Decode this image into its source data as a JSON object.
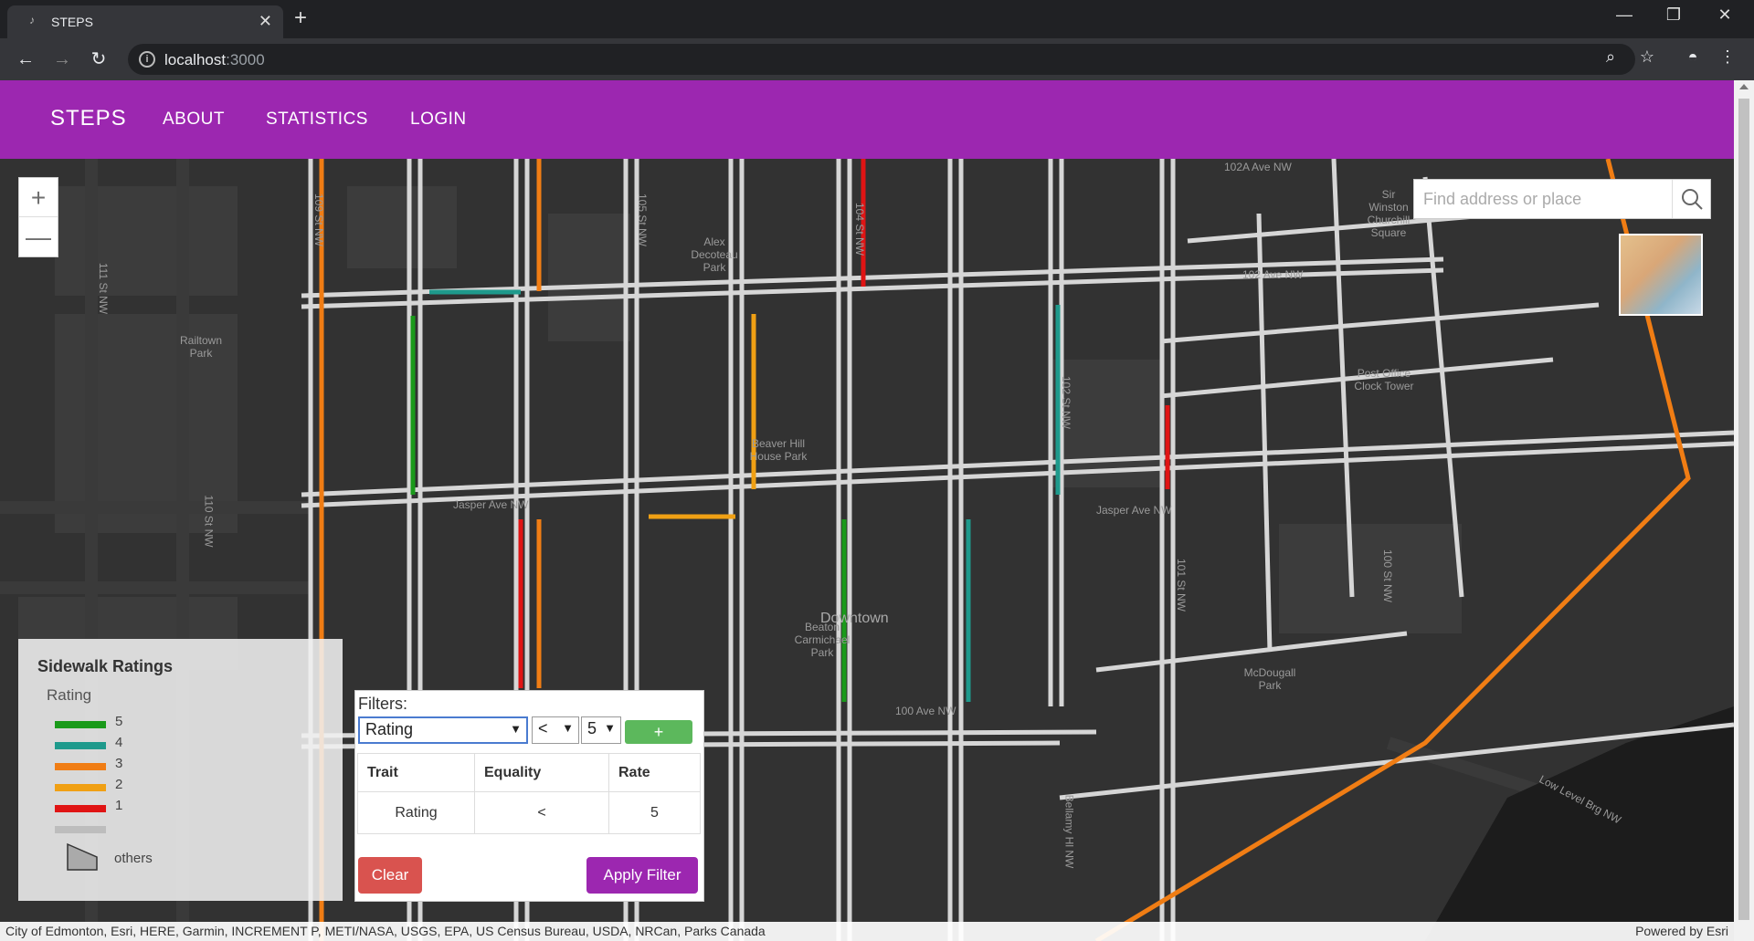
{
  "browser": {
    "tab_title": "STEPS",
    "url_host": "localhost",
    "url_port": ":3000"
  },
  "navbar": {
    "brand": "STEPS",
    "links": [
      "ABOUT",
      "STATISTICS",
      "LOGIN"
    ]
  },
  "map": {
    "search_placeholder": "Find address or place",
    "zoom_in": "+",
    "zoom_out": "—",
    "labels": [
      "102A Ave NW",
      "102 Ave NW",
      "Jasper Ave NW",
      "Jasper Ave NW",
      "Downtown",
      "Alex Decoteau Park",
      "Railtown Park",
      "Beaver Hill House Park",
      "Beaton Carmichael Park",
      "McDougall Park",
      "Sir Winston Churchill Square",
      "Post Office Clock Tower",
      "100 Ave NW",
      "Low Level Brg NW",
      "109 St NW",
      "110 St NW",
      "111 St NW",
      "105 St NW",
      "104 St NW",
      "102 St NW",
      "101 St NW",
      "100 St NW",
      "Bellamy Hl NW"
    ],
    "attribution": "City of Edmonton, Esri, HERE, Garmin, INCREMENT P, METI/NASA, USGS, EPA, US Census Bureau, USDA, NRCan, Parks Canada",
    "powered_by": "Powered by Esri"
  },
  "legend": {
    "title": "Sidewalk Ratings",
    "subtitle": "Rating",
    "items": [
      {
        "label": "5",
        "color": "#1a9a1a"
      },
      {
        "label": "4",
        "color": "#1e9a8c"
      },
      {
        "label": "3",
        "color": "#f07d14"
      },
      {
        "label": "2",
        "color": "#f0a014"
      },
      {
        "label": "1",
        "color": "#e01414"
      },
      {
        "label": "",
        "color": "#bdbdbd"
      }
    ],
    "others_label": "others"
  },
  "filters": {
    "label": "Filters:",
    "trait_selected": "Rating",
    "equality_selected": "<",
    "rate_selected": "5",
    "add_label": "+",
    "table": {
      "headers": [
        "Trait",
        "Equality",
        "Rate"
      ],
      "rows": [
        [
          "Rating",
          "<",
          "5"
        ]
      ]
    },
    "clear_label": "Clear",
    "apply_label": "Apply Filter"
  }
}
